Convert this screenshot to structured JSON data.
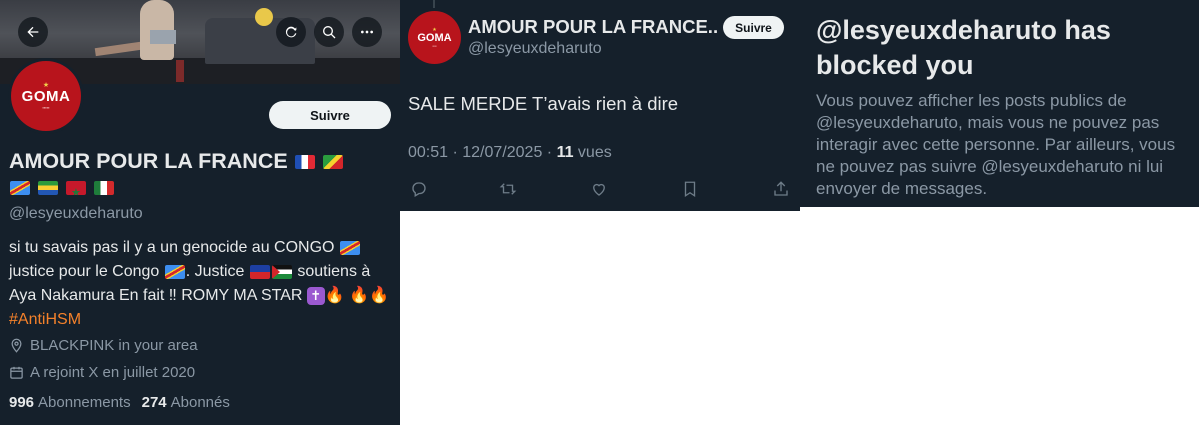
{
  "colors": {
    "background": "#15202b",
    "text_primary": "#e7e9ea",
    "text_secondary": "#8b98a5",
    "hashtag": "#f4812b",
    "follow_button_bg": "#eff3f4",
    "avatar_red": "#b8141c"
  },
  "profile": {
    "header_buttons": {
      "back_icon": "arrow-left-icon",
      "refresh_icon": "refresh-icon",
      "search_icon": "search-icon",
      "more_icon": "more-icon"
    },
    "avatar_text": "GOMA",
    "follow_label": "Suivre",
    "display_name": "AMOUR POUR LA FRANCE",
    "name_flags": [
      "fr",
      "cg",
      "cd",
      "ga",
      "ma",
      "mx"
    ],
    "handle": "@lesyeuxdeharuto",
    "bio": {
      "part1": "si tu savais pas il y a un genocide au CONGO ",
      "part2": " justice pour le Congo ",
      "part3": ". Justice ",
      "part4": " soutiens à Aya Nakamura En fait ‼ ROMY MA STAR ",
      "hashtag": "#AntiHSM"
    },
    "location": "BLACKPINK in your area",
    "joined": "A rejoint X en juillet 2020",
    "following_count": "996",
    "following_label": "Abonnements",
    "followers_count": "274",
    "followers_label": "Abonnés"
  },
  "tweet": {
    "author_name": "AMOUR POUR LA FRANCE...",
    "author_handle": "@lesyeuxdeharuto",
    "follow_label": "Suivre",
    "text": "SALE MERDE T’avais rien à dire",
    "timestamp": "00:51 · 12/07/2025 · ",
    "views_count": "11",
    "views_label": " vues",
    "action_icons": [
      "reply-icon",
      "retweet-icon",
      "like-icon",
      "bookmark-icon",
      "share-icon"
    ]
  },
  "blocked": {
    "title": "@lesyeuxdeharuto has blocked you",
    "body": "Vous pouvez afficher les posts publics de @lesyeuxdeharuto, mais vous ne pouvez pas interagir avec cette personne. Par ailleurs, vous ne pouvez pas suivre @lesyeuxdeharuto ni lui envoyer de messages."
  }
}
